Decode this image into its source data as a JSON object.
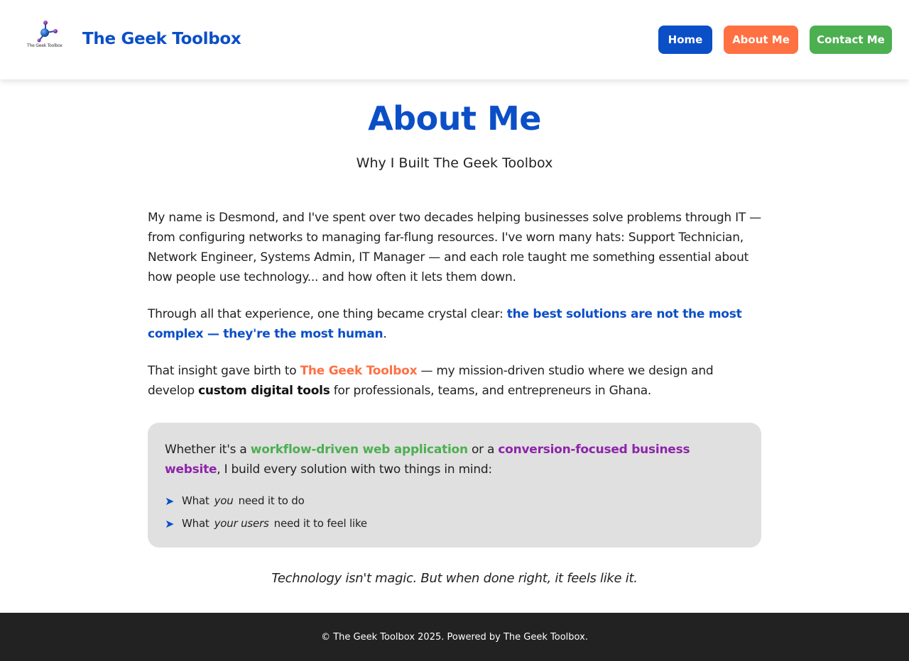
{
  "header": {
    "logo_caption": "The Geek Toolbox",
    "logo_icon": "molecule-logo-icon",
    "site_title": "The Geek Toolbox",
    "nav": {
      "home": "Home",
      "about": "About Me",
      "contact": "Contact Me"
    }
  },
  "main": {
    "title": "About Me",
    "subtitle": "Why I Built The Geek Toolbox",
    "p1": "My name is Desmond, and I've spent over two decades helping businesses solve problems through IT — from configuring networks to managing far-flung resources. I've worn many hats: Support Technician, Network Engineer, Systems Admin, IT Manager — and each role taught me something essential about how people use technology... and how often it lets them down.",
    "p2_pre": "Through all that experience, one thing became crystal clear: ",
    "p2_highlight": "the best solutions are not the most complex — they're the most human",
    "p2_post": ".",
    "p3_pre": "That insight gave birth to ",
    "p3_brand": "The Geek Toolbox",
    "p3_mid": " — my mission-driven studio where we design and develop ",
    "p3_bold": "custom digital tools",
    "p3_post": " for professionals, teams, and entrepreneurs in Ghana.",
    "callout": {
      "pre": "Whether it's a ",
      "green": "workflow-driven web application",
      "mid": " or a ",
      "purple": "conversion-focused business website",
      "post": ", I build every solution with two things in mind:",
      "bullets": [
        {
          "pre": "What",
          "em": "you",
          "post": "need it to do"
        },
        {
          "pre": "What",
          "em": "your users",
          "post": "need it to feel like"
        }
      ],
      "bullet_glyph": "➤"
    },
    "tagline": "Technology isn't magic. But when done right, it feels like it."
  },
  "footer": {
    "text": "© The Geek Toolbox 2025. Powered by The Geek Toolbox."
  },
  "colors": {
    "brand_blue": "#0b4fc7",
    "accent_orange": "#ff7043",
    "accent_green": "#4caf50",
    "accent_purple": "#8e24aa",
    "footer_bg": "#222222",
    "callout_bg": "#e0e0e0"
  }
}
